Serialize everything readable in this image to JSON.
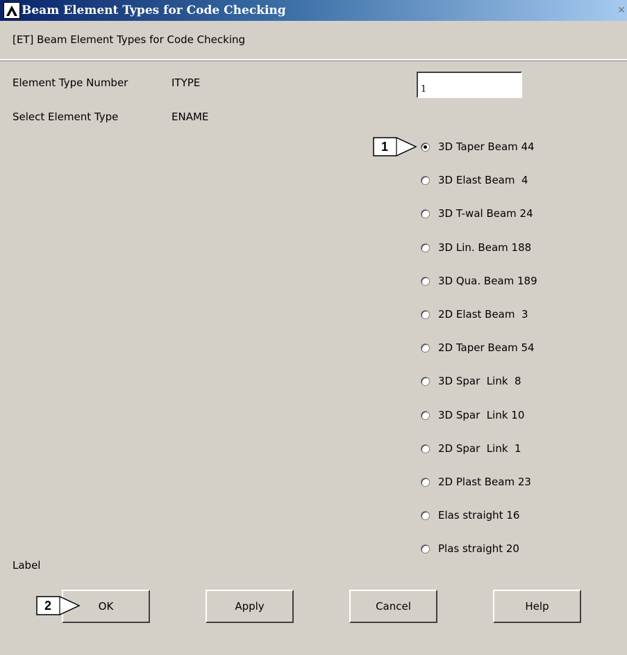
{
  "window": {
    "title": "Beam Element Types for Code Checking",
    "close_glyph": "✕"
  },
  "header": {
    "label": "[ET] Beam Element Types for Code Checking"
  },
  "form": {
    "element_type_number": {
      "label": "Element Type Number",
      "param": "ITYPE",
      "value": "1"
    },
    "select_element_type": {
      "label": "Select Element Type",
      "param": "ENAME"
    },
    "options": [
      {
        "label": "3D Taper Beam 44",
        "checked": true
      },
      {
        "label": "3D Elast Beam  4",
        "checked": false
      },
      {
        "label": "3D T-wal Beam 24",
        "checked": false
      },
      {
        "label": "3D Lin. Beam 188",
        "checked": false
      },
      {
        "label": "3D Qua. Beam 189",
        "checked": false
      },
      {
        "label": "2D Elast Beam  3",
        "checked": false
      },
      {
        "label": "2D Taper Beam 54",
        "checked": false
      },
      {
        "label": "3D Spar  Link  8",
        "checked": false
      },
      {
        "label": "3D Spar  Link 10",
        "checked": false
      },
      {
        "label": "2D Spar  Link  1",
        "checked": false
      },
      {
        "label": "2D Plast Beam 23",
        "checked": false
      },
      {
        "label": "Elas straight 16",
        "checked": false
      },
      {
        "label": "Plas straight 20",
        "checked": false
      }
    ],
    "label_text": "Label"
  },
  "buttons": {
    "ok": "OK",
    "apply": "Apply",
    "cancel": "Cancel",
    "help": "Help"
  },
  "callouts": {
    "one": "1",
    "two": "2"
  }
}
